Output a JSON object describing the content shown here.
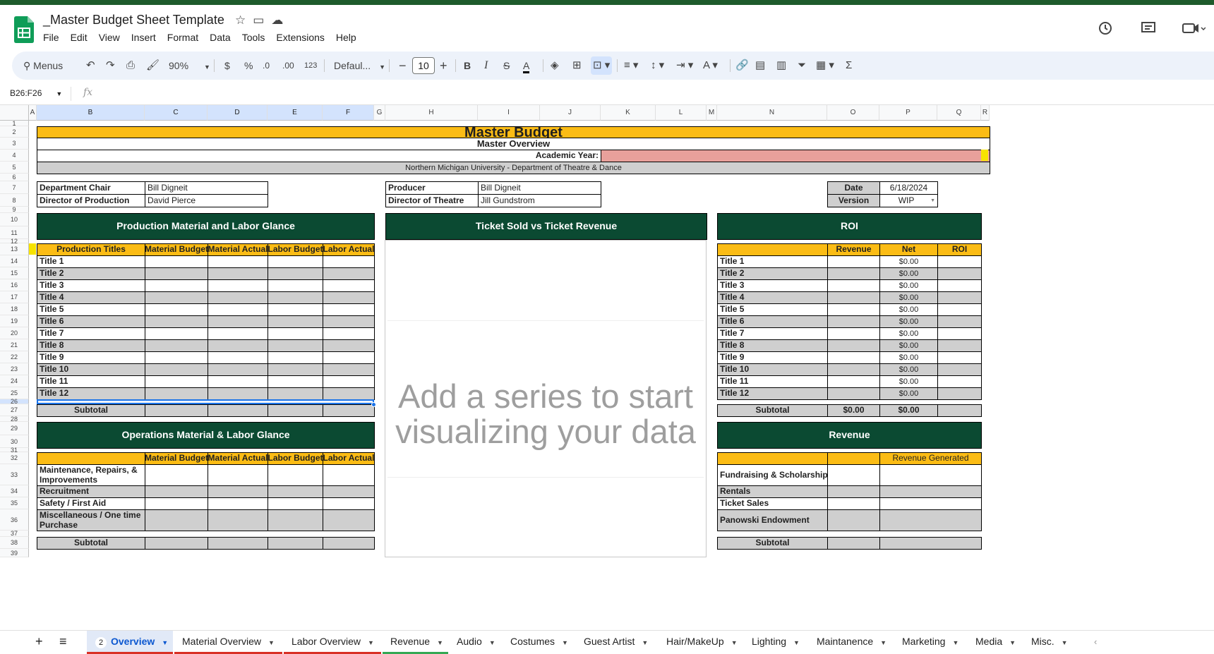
{
  "app": {
    "doc_title": "_Master Budget Sheet Template",
    "menu": [
      "File",
      "Edit",
      "View",
      "Insert",
      "Format",
      "Data",
      "Tools",
      "Extensions",
      "Help"
    ]
  },
  "toolbar": {
    "menus": "Menus",
    "zoom": "90%",
    "currency": "$",
    "percent": "%",
    "dec_decrease": ".0",
    "dec_increase": ".00",
    "number_format": "123",
    "font": "Defaul...",
    "font_size": "10",
    "minus": "−",
    "plus": "+",
    "sigma": "Σ"
  },
  "formula_bar": {
    "name_box": "B26:F26",
    "fx": "fx"
  },
  "columns": [
    "A",
    "B",
    "C",
    "D",
    "E",
    "F",
    "G",
    "H",
    "I",
    "J",
    "K",
    "L",
    "M",
    "N",
    "O",
    "P",
    "Q",
    "R"
  ],
  "rows": [
    "1",
    "2",
    "3",
    "4",
    "5",
    "6",
    "7",
    "8",
    "9",
    "10",
    "11",
    "12",
    "13",
    "14",
    "15",
    "16",
    "17",
    "18",
    "19",
    "20",
    "21",
    "22",
    "23",
    "24",
    "25",
    "26",
    "27",
    "28",
    "29",
    "30",
    "31",
    "32",
    "33",
    "34",
    "35",
    "36",
    "37",
    "38",
    "39"
  ],
  "sheet": {
    "title": "Master Budget",
    "overview": "Master Overview",
    "academic_year_label": "Academic Year:",
    "university": "Northern Michigan University - Department of Theatre & Dance",
    "dept_chair_label": "Department Chair",
    "dept_chair": "Bill Digneit",
    "dir_production_label": "Director of Production",
    "dir_production": "David Pierce",
    "producer_label": "Producer",
    "producer": "Bill Digneit",
    "dir_theatre_label": "Director of Theatre",
    "dir_theatre": "Jill Gundstrom",
    "date_label": "Date",
    "date": "6/18/2024",
    "version_label": "Version",
    "version": "WIP",
    "prod_glance": "Production Material and Labor Glance",
    "chart_header": "Ticket Sold vs Ticket Revenue",
    "roi_header": "ROI",
    "prod_headers": [
      "Production Titles",
      "Material Budget",
      "Material Actual",
      "Labor Budget",
      "Labor Actual"
    ],
    "titles": [
      "Title 1",
      "Title 2",
      "Title 3",
      "Title 4",
      "Title 5",
      "Title 6",
      "Title 7",
      "Title 8",
      "Title 9",
      "Title 10",
      "Title 11",
      "Title 12"
    ],
    "roi_headers": [
      "Revenue",
      "Net",
      "ROI"
    ],
    "net_values": [
      "$0.00",
      "$0.00",
      "$0.00",
      "$0.00",
      "$0.00",
      "$0.00",
      "$0.00",
      "$0.00",
      "$0.00",
      "$0.00",
      "$0.00",
      "$0.00"
    ],
    "subtotal": "Subtotal",
    "roi_subtotal_revenue": "$0.00",
    "roi_subtotal_net": "$0.00",
    "ops_glance": "Operations Material & Labor Glance",
    "ops_headers": [
      "Material Budget",
      "Material Actual",
      "Labor Budget",
      "Labor Actual"
    ],
    "ops_rows": [
      "Maintenance, Repairs, & Improvements",
      "Recruitment",
      "Safety / First Aid",
      "Miscellaneous / One time Purchase"
    ],
    "revenue_header": "Revenue",
    "revenue_generated": "Revenue Generated",
    "revenue_rows": [
      "Fundraising & Scholarships",
      "Rentals",
      "Ticket Sales",
      "Panowski Endowment"
    ],
    "chart_placeholder": "Add a series to start visualizing your data"
  },
  "sheet_tabs": {
    "overview_badge": "2",
    "tabs": [
      "Overview",
      "Material Overview",
      "Labor Overview",
      "Revenue",
      "Audio",
      "Costumes",
      "Guest Artist",
      "Hair/MakeUp",
      "Lighting",
      "Maintanence",
      "Marketing",
      "Media",
      "Misc."
    ]
  },
  "colors": {
    "header_gold": "#fbbc15",
    "header_green": "#0b4a32",
    "academic_year_fill": "#e8a09b",
    "row_gray": "#cfcfcf"
  }
}
